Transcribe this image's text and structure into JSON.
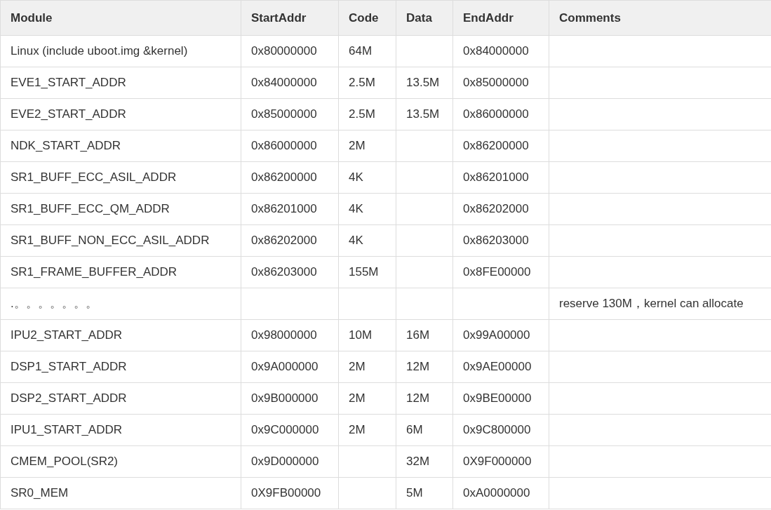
{
  "table": {
    "columns": [
      "Module",
      "StartAddr",
      "Code",
      "Data",
      "EndAddr",
      "Comments"
    ],
    "rows": [
      [
        "Linux (include uboot.img &kernel)",
        "0x80000000",
        "64M",
        "",
        "0x84000000",
        ""
      ],
      [
        "EVE1_START_ADDR",
        "0x84000000",
        "2.5M",
        "13.5M",
        "0x85000000",
        ""
      ],
      [
        "EVE2_START_ADDR",
        "0x85000000",
        "2.5M",
        "13.5M",
        "0x86000000",
        ""
      ],
      [
        "NDK_START_ADDR",
        "0x86000000",
        "2M",
        "",
        "0x86200000",
        ""
      ],
      [
        "SR1_BUFF_ECC_ASIL_ADDR",
        "0x86200000",
        "4K",
        "",
        "0x86201000",
        ""
      ],
      [
        "SR1_BUFF_ECC_QM_ADDR",
        "0x86201000",
        "4K",
        "",
        "0x86202000",
        ""
      ],
      [
        "SR1_BUFF_NON_ECC_ASIL_ADDR",
        "0x86202000",
        "4K",
        "",
        "0x86203000",
        ""
      ],
      [
        "SR1_FRAME_BUFFER_ADDR",
        "0x86203000",
        "155M",
        "",
        "0x8FE00000",
        ""
      ],
      [
        ".。。。。。。。",
        "",
        "",
        "",
        "",
        "reserve 130M，kernel can allocate"
      ],
      [
        "IPU2_START_ADDR",
        "0x98000000",
        "10M",
        "16M",
        "0x99A00000",
        ""
      ],
      [
        "DSP1_START_ADDR",
        "0x9A000000",
        "2M",
        "12M",
        "0x9AE00000",
        ""
      ],
      [
        "DSP2_START_ADDR",
        "0x9B000000",
        "2M",
        "12M",
        "0x9BE00000",
        ""
      ],
      [
        "IPU1_START_ADDR",
        "0x9C000000",
        "2M",
        "6M",
        "0x9C800000",
        ""
      ],
      [
        "CMEM_POOL(SR2)",
        "0x9D000000",
        "",
        "32M",
        "0X9F000000",
        ""
      ],
      [
        "SR0_MEM",
        "0X9FB00000",
        "",
        "5M",
        "0xA0000000",
        ""
      ]
    ]
  }
}
